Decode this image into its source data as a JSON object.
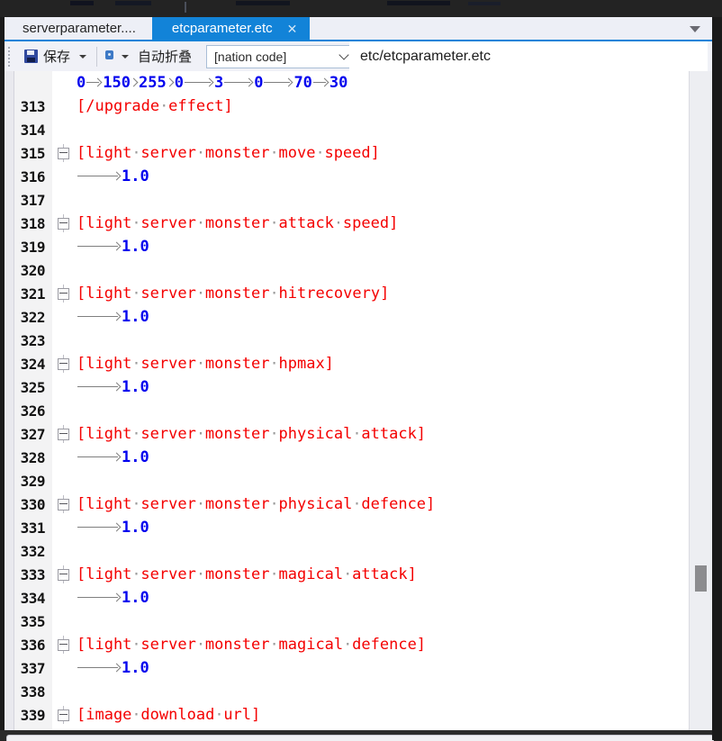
{
  "tab_bar": {
    "inactive_tab": "serverparameter....",
    "active_tab": "etcparameter.etc",
    "close_label": "✕"
  },
  "toolbar": {
    "save_label": "保存",
    "autofold_label": "自动折叠",
    "nation_combo_value": "[nation code]",
    "path": "etc/etcparameter.etc"
  },
  "colors": {
    "accent_blue": "#1283d8",
    "code_red": "#f40000",
    "code_blue": "#0000ee",
    "whitespace_gray": "#7f7f7f"
  },
  "editor": {
    "lines": [
      {
        "n": "",
        "f": false,
        "s": [
          [
            "b",
            "0"
          ],
          [
            "t",
            "m"
          ],
          [
            "b",
            "150"
          ],
          [
            "t",
            "s"
          ],
          [
            "b",
            "255"
          ],
          [
            "t",
            "s"
          ],
          [
            "b",
            "0"
          ],
          [
            "t",
            "l"
          ],
          [
            "b",
            "3"
          ],
          [
            "t",
            "l"
          ],
          [
            "b",
            "0"
          ],
          [
            "t",
            "l"
          ],
          [
            "b",
            "70"
          ],
          [
            "t",
            "m"
          ],
          [
            "b",
            "30"
          ]
        ]
      },
      {
        "n": "313",
        "f": false,
        "s": [
          [
            "r",
            "[/upgrade"
          ],
          [
            "d"
          ],
          [
            "r",
            "effect]"
          ]
        ]
      },
      {
        "n": "314",
        "f": false,
        "s": []
      },
      {
        "n": "315",
        "f": true,
        "s": [
          [
            "r",
            "[light"
          ],
          [
            "d"
          ],
          [
            "r",
            "server"
          ],
          [
            "d"
          ],
          [
            "r",
            "monster"
          ],
          [
            "d"
          ],
          [
            "r",
            "move"
          ],
          [
            "d"
          ],
          [
            "r",
            "speed]"
          ]
        ]
      },
      {
        "n": "316",
        "f": false,
        "s": [
          [
            "t",
            "xl"
          ],
          [
            "b",
            "1.0"
          ]
        ]
      },
      {
        "n": "317",
        "f": false,
        "s": []
      },
      {
        "n": "318",
        "f": true,
        "s": [
          [
            "r",
            "[light"
          ],
          [
            "d"
          ],
          [
            "r",
            "server"
          ],
          [
            "d"
          ],
          [
            "r",
            "monster"
          ],
          [
            "d"
          ],
          [
            "r",
            "attack"
          ],
          [
            "d"
          ],
          [
            "r",
            "speed]"
          ]
        ]
      },
      {
        "n": "319",
        "f": false,
        "s": [
          [
            "t",
            "xl"
          ],
          [
            "b",
            "1.0"
          ]
        ]
      },
      {
        "n": "320",
        "f": false,
        "s": []
      },
      {
        "n": "321",
        "f": true,
        "s": [
          [
            "r",
            "[light"
          ],
          [
            "d"
          ],
          [
            "r",
            "server"
          ],
          [
            "d"
          ],
          [
            "r",
            "monster"
          ],
          [
            "d"
          ],
          [
            "r",
            "hitrecovery]"
          ]
        ]
      },
      {
        "n": "322",
        "f": false,
        "s": [
          [
            "t",
            "xl"
          ],
          [
            "b",
            "1.0"
          ]
        ]
      },
      {
        "n": "323",
        "f": false,
        "s": []
      },
      {
        "n": "324",
        "f": true,
        "s": [
          [
            "r",
            "[light"
          ],
          [
            "d"
          ],
          [
            "r",
            "server"
          ],
          [
            "d"
          ],
          [
            "r",
            "monster"
          ],
          [
            "d"
          ],
          [
            "r",
            "hpmax]"
          ]
        ]
      },
      {
        "n": "325",
        "f": false,
        "s": [
          [
            "t",
            "xl"
          ],
          [
            "b",
            "1.0"
          ]
        ]
      },
      {
        "n": "326",
        "f": false,
        "s": []
      },
      {
        "n": "327",
        "f": true,
        "s": [
          [
            "r",
            "[light"
          ],
          [
            "d"
          ],
          [
            "r",
            "server"
          ],
          [
            "d"
          ],
          [
            "r",
            "monster"
          ],
          [
            "d"
          ],
          [
            "r",
            "physical"
          ],
          [
            "d"
          ],
          [
            "r",
            "attack]"
          ]
        ]
      },
      {
        "n": "328",
        "f": false,
        "s": [
          [
            "t",
            "xl"
          ],
          [
            "b",
            "1.0"
          ]
        ]
      },
      {
        "n": "329",
        "f": false,
        "s": []
      },
      {
        "n": "330",
        "f": true,
        "s": [
          [
            "r",
            "[light"
          ],
          [
            "d"
          ],
          [
            "r",
            "server"
          ],
          [
            "d"
          ],
          [
            "r",
            "monster"
          ],
          [
            "d"
          ],
          [
            "r",
            "physical"
          ],
          [
            "d"
          ],
          [
            "r",
            "defence]"
          ]
        ]
      },
      {
        "n": "331",
        "f": false,
        "s": [
          [
            "t",
            "xl"
          ],
          [
            "b",
            "1.0"
          ]
        ]
      },
      {
        "n": "332",
        "f": false,
        "s": []
      },
      {
        "n": "333",
        "f": true,
        "s": [
          [
            "r",
            "[light"
          ],
          [
            "d"
          ],
          [
            "r",
            "server"
          ],
          [
            "d"
          ],
          [
            "r",
            "monster"
          ],
          [
            "d"
          ],
          [
            "r",
            "magical"
          ],
          [
            "d"
          ],
          [
            "r",
            "attack]"
          ]
        ]
      },
      {
        "n": "334",
        "f": false,
        "s": [
          [
            "t",
            "xl"
          ],
          [
            "b",
            "1.0"
          ]
        ]
      },
      {
        "n": "335",
        "f": false,
        "s": []
      },
      {
        "n": "336",
        "f": true,
        "s": [
          [
            "r",
            "[light"
          ],
          [
            "d"
          ],
          [
            "r",
            "server"
          ],
          [
            "d"
          ],
          [
            "r",
            "monster"
          ],
          [
            "d"
          ],
          [
            "r",
            "magical"
          ],
          [
            "d"
          ],
          [
            "r",
            "defence]"
          ]
        ]
      },
      {
        "n": "337",
        "f": false,
        "s": [
          [
            "t",
            "xl"
          ],
          [
            "b",
            "1.0"
          ]
        ]
      },
      {
        "n": "338",
        "f": false,
        "s": []
      },
      {
        "n": "339",
        "f": true,
        "s": [
          [
            "r",
            "[image"
          ],
          [
            "d"
          ],
          [
            "r",
            "download"
          ],
          [
            "d"
          ],
          [
            "r",
            "url]"
          ]
        ]
      }
    ]
  }
}
